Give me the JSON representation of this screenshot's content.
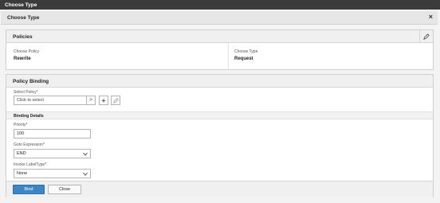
{
  "window": {
    "title": "Choose Type"
  },
  "dialog": {
    "title": "Choose Type",
    "close_glyph": "×"
  },
  "policies": {
    "title": "Policies",
    "choose_policy_label": "Choose Policy",
    "choose_policy_value": "Rewrite",
    "choose_type_label": "Choose Type",
    "choose_type_value": "Request",
    "edit_icon": "pencil-icon"
  },
  "policy_binding": {
    "title": "Policy Binding",
    "select_policy_label": "Select Policy*",
    "select_policy_placeholder": "Click to select",
    "arrow_glyph": ">",
    "add_glyph": "+",
    "binding_details_title": "Binding Details",
    "priority_label": "Priority*",
    "priority_value": "100",
    "goto_label": "Goto Expression*",
    "goto_value": "END",
    "invoke_label": "Invoke LabelType*",
    "invoke_value": "None"
  },
  "footer": {
    "bind_label": "Bind",
    "close_label": "Close"
  },
  "colors": {
    "primary": "#3a87c8",
    "titlebar": "#3b3b3b"
  }
}
